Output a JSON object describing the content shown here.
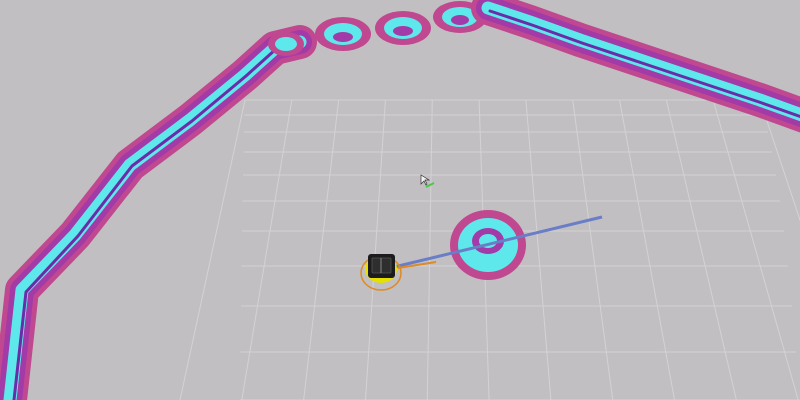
{
  "viewer": {
    "background_color": "#c2bfc2",
    "grid_color": "#d4d2d4",
    "costmap_colors": {
      "lethal": "#6a2ca8",
      "inscribed": "#5ee8ec",
      "inflated_high": "#a23aa8",
      "inflated_low": "#c04890"
    },
    "robot": {
      "icon": "turtlebot-robot-icon",
      "body_color": "#1c1c1c",
      "trim_color": "#e6e000",
      "footprint_color": "#e08a20"
    },
    "path_color": "#6a7ec8",
    "goal_marker_color": "#44cc44"
  }
}
